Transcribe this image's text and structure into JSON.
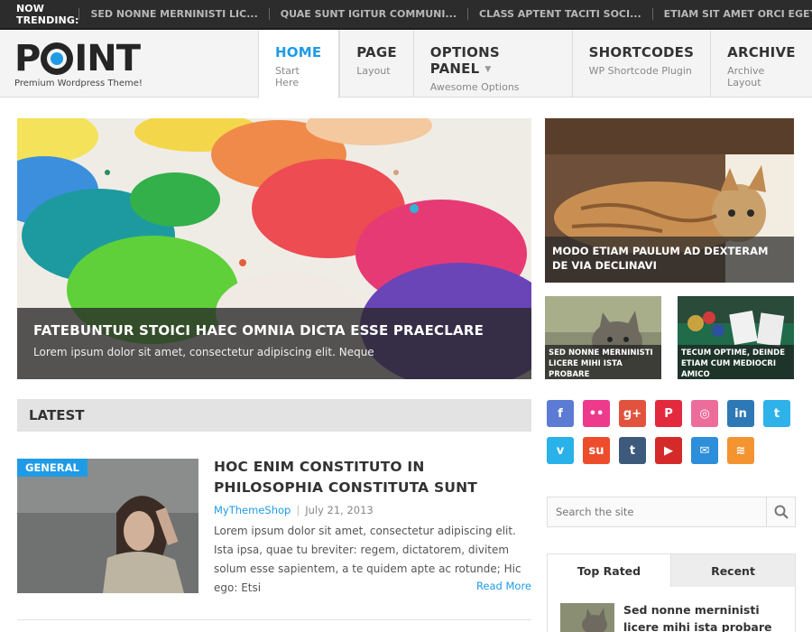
{
  "trending": {
    "label": "NOW TRENDING:",
    "items": [
      "SED NONNE MERNINISTI LIC...",
      "QUAE SUNT IGITUR COMMUNI...",
      "CLASS APTENT TACITI SOCI...",
      "ETIAM SIT AMET ORCI EGET..."
    ]
  },
  "brand": {
    "name_left": "P",
    "name_right": "INT",
    "tagline": "Premium Wordpress Theme!"
  },
  "nav": [
    {
      "title": "HOME",
      "sub": "Start Here",
      "active": true
    },
    {
      "title": "PAGE",
      "sub": "Layout"
    },
    {
      "title": "OPTIONS PANEL",
      "sub": "Awesome Options",
      "has_dropdown": true
    },
    {
      "title": "SHORTCODES",
      "sub": "WP Shortcode Plugin"
    },
    {
      "title": "ARCHIVE",
      "sub": "Archive Layout"
    }
  ],
  "featured": {
    "main": {
      "title": "FATEBUNTUR STOICI HAEC OMNIA DICTA ESSE PRAECLARE",
      "excerpt": "Lorem ipsum dolor sit amet, consectetur adipiscing elit. Neque"
    },
    "side_big": {
      "title": "MODO ETIAM PAULUM AD DEXTERAM DE VIA DECLINAVI"
    },
    "side_small": [
      {
        "title": "SED NONNE MERNINISTI LICERE MIHI ISTA PROBARE"
      },
      {
        "title": "TECUM OPTIME, DEINDE ETIAM CUM MEDIOCRI AMICO"
      }
    ]
  },
  "latest": {
    "heading": "LATEST",
    "post": {
      "category": "GENERAL",
      "title": "HOC ENIM CONSTITUTO IN PHILOSOPHIA CONSTITUTA SUNT",
      "author": "MyThemeShop",
      "separator": "|",
      "date": "July 21, 2013",
      "excerpt": "Lorem ipsum dolor sit amet, consectetur adipiscing elit. Ista ipsa, quae tu breviter: regem, dictatorem, divitem solum esse sapientem, a te quidem apte ac rotunde; Hic ego: Etsi",
      "read_more": "Read More"
    }
  },
  "social": {
    "row1": [
      {
        "name": "facebook",
        "glyph": "f",
        "color": "#5b7bd5"
      },
      {
        "name": "flickr",
        "glyph": "••",
        "color": "#ee3a8c"
      },
      {
        "name": "google-plus",
        "glyph": "g+",
        "color": "#e2533f"
      },
      {
        "name": "pinterest",
        "glyph": "P",
        "color": "#e2293e"
      },
      {
        "name": "dribbble",
        "glyph": "◎",
        "color": "#ed6d9a"
      },
      {
        "name": "linkedin",
        "glyph": "in",
        "color": "#2d79b5"
      },
      {
        "name": "twitter",
        "glyph": "t",
        "color": "#2fb2ea"
      }
    ],
    "row2": [
      {
        "name": "vimeo",
        "glyph": "v",
        "color": "#29b1e9"
      },
      {
        "name": "stumbleupon",
        "glyph": "su",
        "color": "#ed4d2b"
      },
      {
        "name": "tumblr",
        "glyph": "t",
        "color": "#3d5a7c"
      },
      {
        "name": "youtube",
        "glyph": "▶",
        "color": "#d52a2a"
      },
      {
        "name": "email",
        "glyph": "✉",
        "color": "#2d8ed9"
      },
      {
        "name": "rss",
        "glyph": "≋",
        "color": "#f39431"
      }
    ]
  },
  "search": {
    "placeholder": "Search the site"
  },
  "tabs_widget": {
    "tabs": [
      "Top Rated",
      "Recent"
    ],
    "post_title": "Sed nonne merninisti licere mihi ista probare"
  },
  "colors": {
    "accent": "#1f9be6",
    "dark": "#2c2c2c"
  }
}
